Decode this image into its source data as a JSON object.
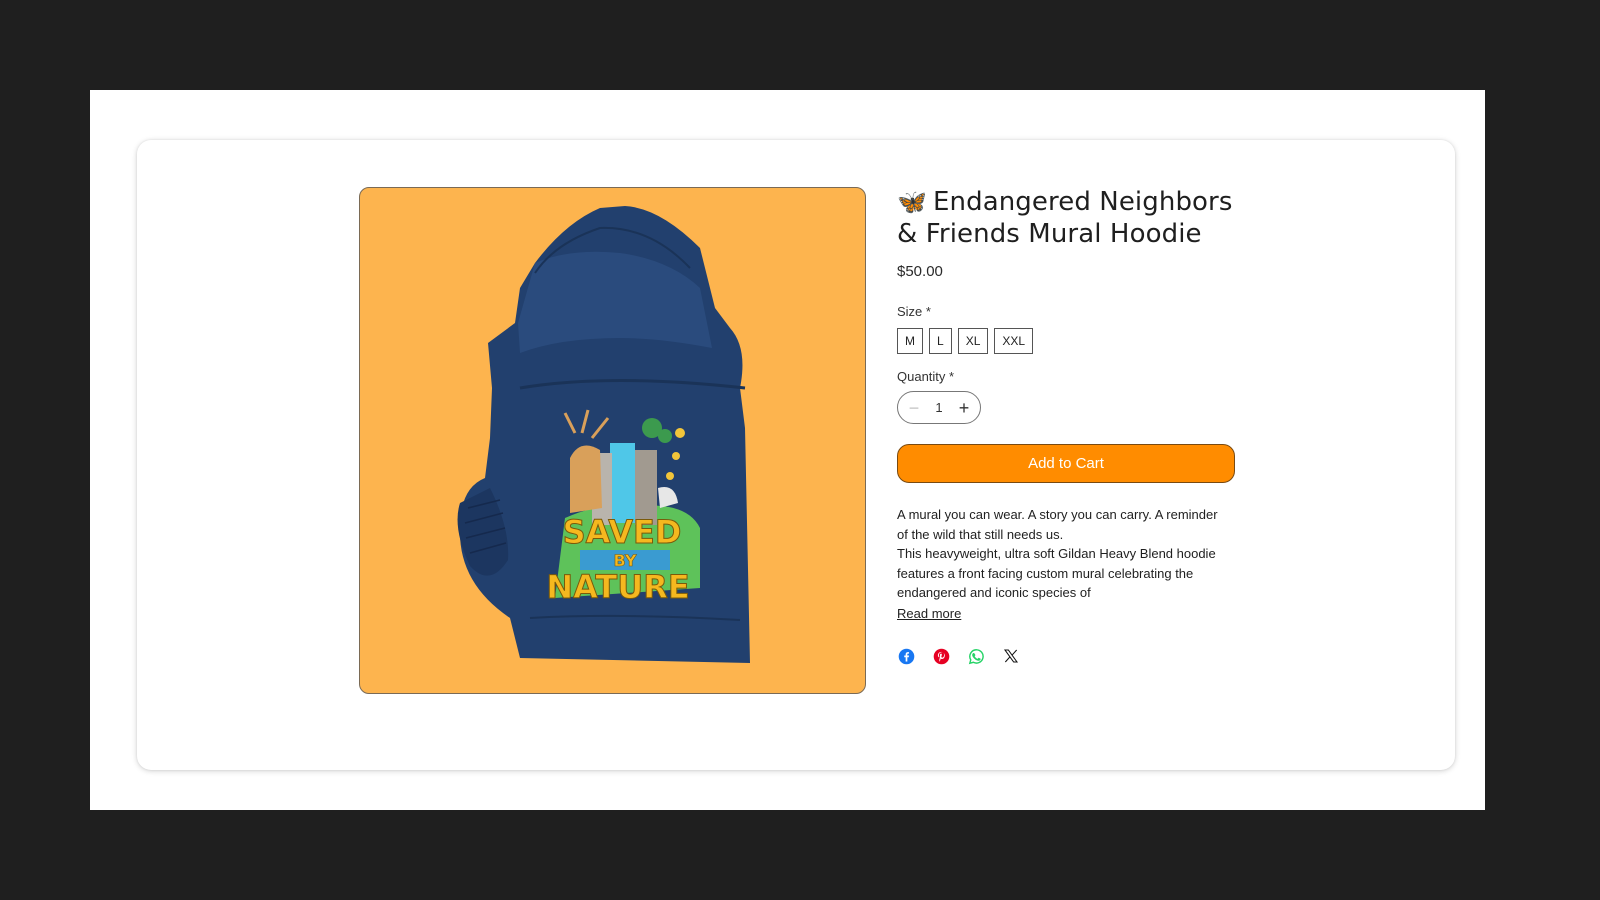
{
  "product": {
    "title_icon": "butterfly-icon",
    "title": "Endangered Neighbors & Friends Mural Hoodie",
    "price": "$50.00",
    "image_alt": "SAVED BY NATURE",
    "size": {
      "label": "Size *",
      "options": [
        "M",
        "L",
        "XL",
        "XXL"
      ]
    },
    "quantity": {
      "label": "Quantity *",
      "value": "1"
    },
    "add_to_cart_label": "Add to Cart",
    "description": {
      "line1": "A mural you can wear. A story you can carry. A reminder of the wild that still needs us.",
      "line2": "This heavyweight, ultra soft Gildan Heavy Blend hoodie features a front facing custom mural celebrating the endangered and iconic species of",
      "read_more": "Read more"
    },
    "share": [
      {
        "icon": "facebook-icon",
        "color": "#1877f2"
      },
      {
        "icon": "pinterest-icon",
        "color": "#e60023"
      },
      {
        "icon": "whatsapp-icon",
        "color": "#25d366"
      },
      {
        "icon": "x-icon",
        "color": "#111111"
      }
    ]
  },
  "colors": {
    "accent": "#ff8c00",
    "image_background": "#fdb44e",
    "hoodie": "#22406e",
    "page_background": "#1f1f1f"
  }
}
